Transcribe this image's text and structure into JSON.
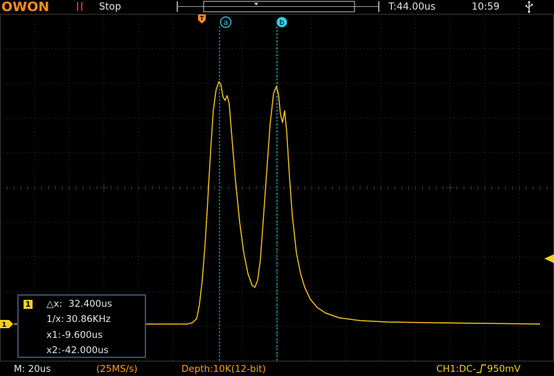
{
  "header": {
    "logo": "OWON",
    "run_state": "Stop",
    "trigger_time": "T:44.00us",
    "clock": "10:59",
    "colors": {
      "logo": "#ff8a1a",
      "pause_icon": "#e0261f"
    }
  },
  "markers": {
    "trigger_label": "T",
    "cursor_a_label": "a",
    "cursor_b_label": "b"
  },
  "measurement": {
    "channel": "1",
    "delta_x_label": "△x:",
    "delta_x_value": "32.400us",
    "inv_x_label": "1/x:",
    "inv_x_value": "30.86KHz",
    "x1_label": "x1:",
    "x1_value": "-9.600us",
    "x2_label": "x2:",
    "x2_value": "-42.000us"
  },
  "footer": {
    "timebase": "M: 20us",
    "sample_rate": "(25MS/s)",
    "depth": "Depth:10K(12-bit)",
    "ch1_prefix": "CH1:DC-",
    "ch1_level": "950mV"
  },
  "waveform": {
    "color": "#f5c518",
    "cursor_color": "#2bd0e8",
    "grid_color": "#3a3a3a",
    "channel_marker": "1"
  }
}
